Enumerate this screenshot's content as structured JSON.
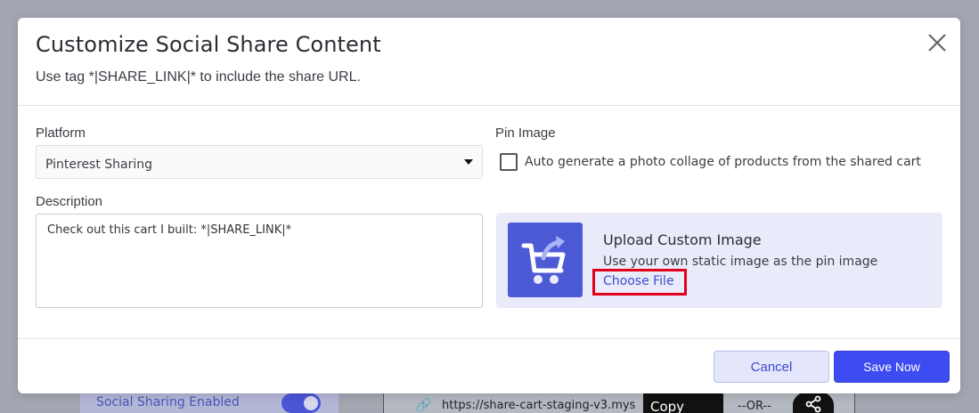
{
  "background": {
    "social_sharing_label": "Social Sharing Enabled",
    "share_url": "https://share-cart-staging-v3.mys",
    "copy_link_label": "Copy Link..",
    "or_label": "--OR--",
    "link_icon": "link-icon",
    "share_icon": "share-icon"
  },
  "modal": {
    "title": "Customize Social Share Content",
    "subtitle": "Use tag *|SHARE_LINK|* to include the share URL.",
    "close_icon": "close-icon",
    "platform": {
      "label": "Platform",
      "selected": "Pinterest Sharing"
    },
    "description": {
      "label": "Description",
      "value": "Check out this cart I built: *|SHARE_LINK|*"
    },
    "pin_image": {
      "label": "Pin Image",
      "auto_generate_label": "Auto generate a photo collage of products from the shared cart",
      "auto_generate_checked": false
    },
    "upload": {
      "title": "Upload Custom Image",
      "description": "Use your own static image as the pin image",
      "choose_file_label": "Choose File",
      "logo_icon": "cart-share-logo-icon"
    },
    "footer": {
      "cancel_label": "Cancel",
      "save_label": "Save Now"
    }
  },
  "colors": {
    "accent": "#3d4cf0",
    "link": "#3f4ccf",
    "highlight_border": "#e3001b",
    "upload_panel_bg": "#e9ebfa",
    "logo_bg": "#4d5ad6"
  }
}
